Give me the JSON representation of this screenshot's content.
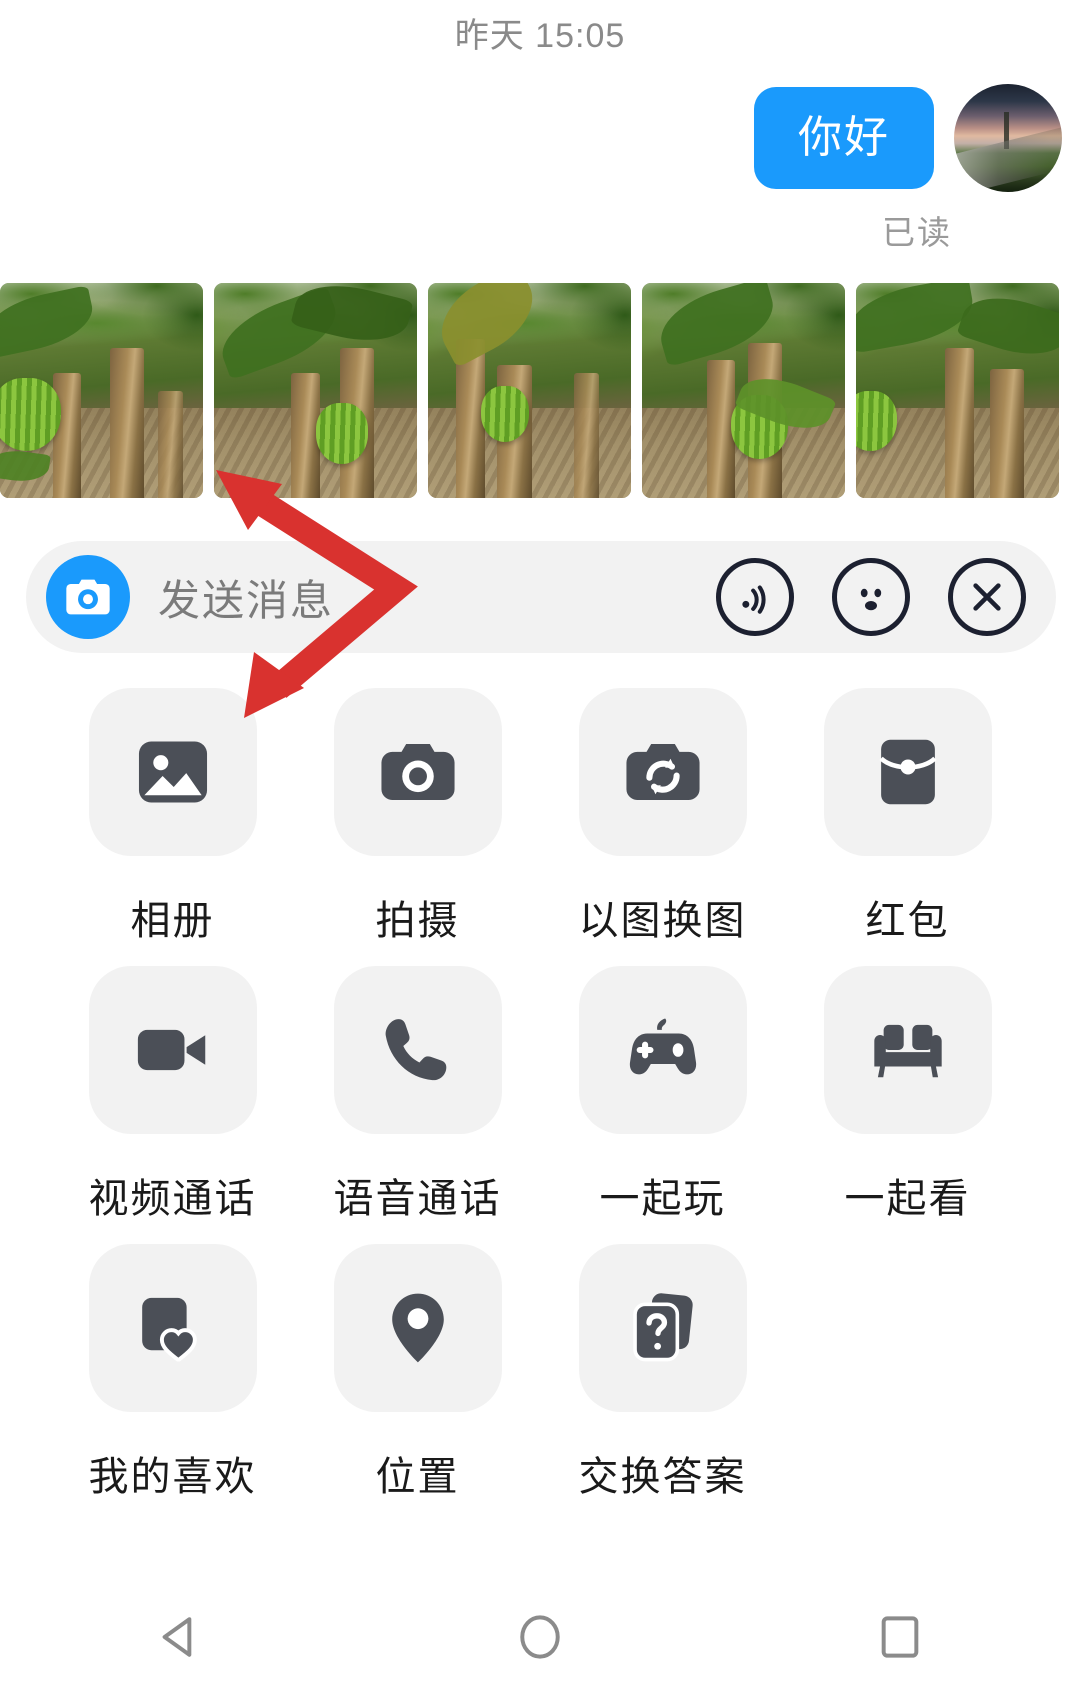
{
  "chat": {
    "timestamp": "昨天 15:05",
    "message": {
      "text": "你好",
      "bubble_color": "#1a9afc",
      "read_status": "已读"
    },
    "avatar_name": "user-avatar",
    "photos": [
      {
        "caption": "banana-plantation-1"
      },
      {
        "caption": "banana-plantation-2"
      },
      {
        "caption": "banana-plantation-3"
      },
      {
        "caption": "banana-plantation-4"
      },
      {
        "caption": "banana-plantation-5"
      }
    ]
  },
  "input_bar": {
    "camera_icon": "camera-icon",
    "placeholder": "发送消息",
    "value": "",
    "icons": [
      {
        "name": "voice-wave-icon"
      },
      {
        "name": "emoji-face-icon"
      },
      {
        "name": "close-x-icon"
      }
    ]
  },
  "panel": {
    "rows": [
      [
        {
          "icon": "photo-album-icon",
          "label": "相册"
        },
        {
          "icon": "camera-icon",
          "label": "拍摄"
        },
        {
          "icon": "image-swap-icon",
          "label": "以图换图"
        },
        {
          "icon": "red-packet-icon",
          "label": "红包"
        }
      ],
      [
        {
          "icon": "video-camera-icon",
          "label": "视频通话"
        },
        {
          "icon": "phone-icon",
          "label": "语音通话"
        },
        {
          "icon": "game-controller-icon",
          "label": "一起玩"
        },
        {
          "icon": "sofa-icon",
          "label": "一起看"
        }
      ],
      [
        {
          "icon": "favorite-card-icon",
          "label": "我的喜欢"
        },
        {
          "icon": "location-pin-icon",
          "label": "位置"
        },
        {
          "icon": "question-cards-icon",
          "label": "交换答案"
        }
      ]
    ]
  },
  "annotation": {
    "color": "#d9322f",
    "name": "red-double-arrow"
  },
  "navbar": {
    "buttons": [
      {
        "name": "back-triangle-icon"
      },
      {
        "name": "home-circle-icon"
      },
      {
        "name": "recents-square-icon"
      }
    ]
  }
}
